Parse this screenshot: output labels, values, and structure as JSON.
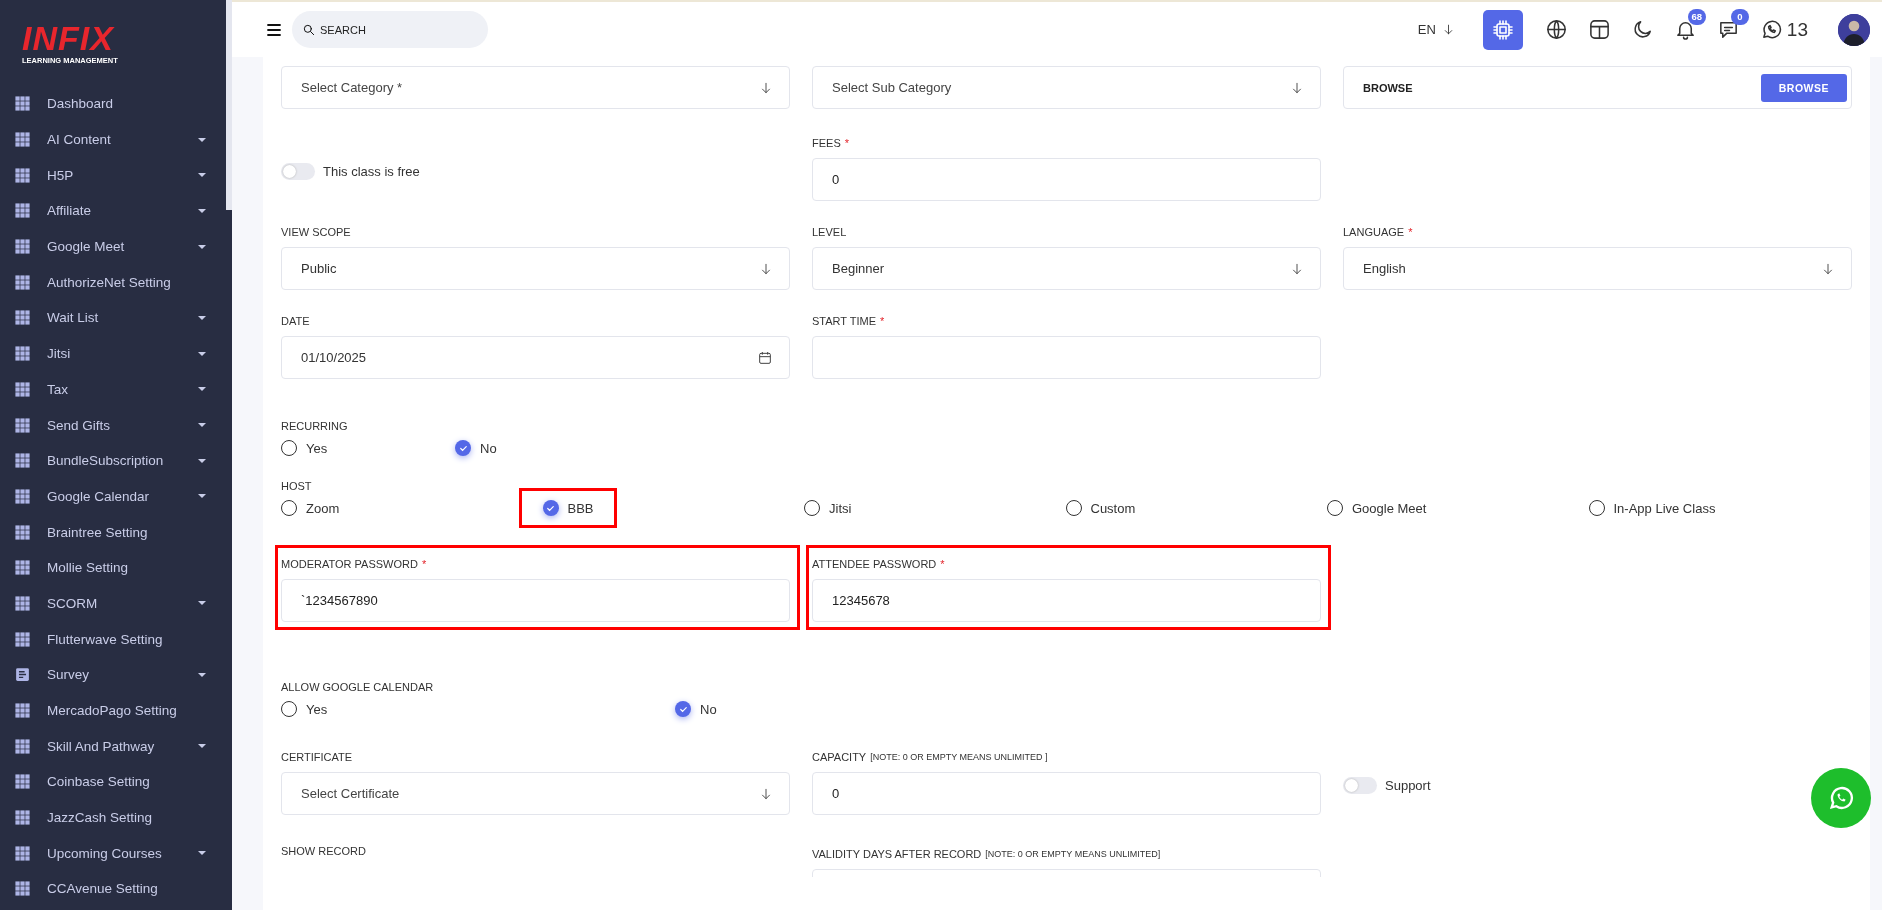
{
  "sidebar": {
    "logo": {
      "title": "INFIX",
      "subtitle": "LEARNING MANAGEMENT"
    },
    "items": [
      {
        "label": "Dashboard",
        "kind": "grid",
        "expandable": false
      },
      {
        "label": "AI Content",
        "kind": "grid",
        "expandable": true
      },
      {
        "label": "H5P",
        "kind": "grid",
        "expandable": true
      },
      {
        "label": "Affiliate",
        "kind": "grid",
        "expandable": true
      },
      {
        "label": "Google Meet",
        "kind": "grid",
        "expandable": true
      },
      {
        "label": "AuthorizeNet Setting",
        "kind": "grid",
        "expandable": false
      },
      {
        "label": "Wait List",
        "kind": "grid",
        "expandable": true
      },
      {
        "label": "Jitsi",
        "kind": "grid",
        "expandable": true
      },
      {
        "label": "Tax",
        "kind": "grid",
        "expandable": true
      },
      {
        "label": "Send Gifts",
        "kind": "grid",
        "expandable": true
      },
      {
        "label": "BundleSubscription",
        "kind": "grid",
        "expandable": true
      },
      {
        "label": "Google Calendar",
        "kind": "grid",
        "expandable": true
      },
      {
        "label": "Braintree Setting",
        "kind": "grid",
        "expandable": false
      },
      {
        "label": "Mollie Setting",
        "kind": "grid",
        "expandable": false
      },
      {
        "label": "SCORM",
        "kind": "grid",
        "expandable": true
      },
      {
        "label": "Flutterwave Setting",
        "kind": "grid",
        "expandable": false
      },
      {
        "label": "Survey",
        "kind": "document",
        "expandable": true
      },
      {
        "label": "MercadoPago Setting",
        "kind": "grid",
        "expandable": false
      },
      {
        "label": "Skill And Pathway",
        "kind": "grid",
        "expandable": true
      },
      {
        "label": "Coinbase Setting",
        "kind": "grid",
        "expandable": false
      },
      {
        "label": "JazzCash Setting",
        "kind": "grid",
        "expandable": false
      },
      {
        "label": "Upcoming Courses",
        "kind": "grid",
        "expandable": true
      },
      {
        "label": "CCAvenue Setting",
        "kind": "grid",
        "expandable": false
      }
    ]
  },
  "header": {
    "search": {
      "placeholder": "SEARCH"
    },
    "language": "EN",
    "ai_button": {
      "active": true
    },
    "notifications": "68",
    "messages": "0",
    "whatsapp_count": "13"
  },
  "form": {
    "rows": [
      {
        "kind": "fields",
        "fields": [
          {
            "kind": "select",
            "placeholder": "Select Category *"
          },
          {
            "kind": "select",
            "placeholder": "Select Sub Category"
          },
          {
            "kind": "browse",
            "value": "BROWSE",
            "button": "BROWSE"
          }
        ]
      },
      {
        "kind": "fields",
        "fields": [
          {
            "kind": "toggle",
            "label": "This class is free",
            "on": false
          },
          {
            "kind": "input",
            "label": "FEES",
            "required_mark": "*",
            "value": "0"
          }
        ]
      },
      {
        "kind": "fields",
        "fields": [
          {
            "kind": "select",
            "label": "VIEW SCOPE",
            "value": "Public"
          },
          {
            "kind": "select",
            "label": "LEVEL",
            "value": "Beginner"
          },
          {
            "kind": "select",
            "label": "LANGUAGE",
            "required_mark": "*",
            "value": "English"
          }
        ]
      },
      {
        "kind": "fields",
        "fields": [
          {
            "kind": "date",
            "label": "DATE",
            "value": "01/10/2025"
          },
          {
            "kind": "input",
            "label": "START TIME",
            "required_mark": "*"
          }
        ]
      },
      {
        "kind": "radio",
        "label": "RECURRING",
        "options": [
          {
            "label": "Yes",
            "selected": false
          },
          {
            "label": "No",
            "selected": true
          }
        ]
      },
      {
        "kind": "radio",
        "label": "HOST",
        "options": [
          {
            "label": "Zoom",
            "selected": false
          },
          {
            "label": "BBB",
            "selected": true,
            "highlighted": true
          },
          {
            "label": "Jitsi",
            "selected": false
          },
          {
            "label": "Custom",
            "selected": false
          },
          {
            "label": "Google Meet",
            "selected": false
          },
          {
            "label": "In-App Live Class",
            "selected": false
          }
        ]
      },
      {
        "kind": "fields",
        "fields": [
          {
            "kind": "input",
            "label": "MODERATOR PASSWORD",
            "required_mark": "*",
            "value": "`1234567890",
            "highlighted": true
          },
          {
            "kind": "input",
            "label": "ATTENDEE PASSWORD",
            "required_mark": "*",
            "value": "12345678",
            "highlighted": true
          }
        ]
      },
      {
        "kind": "radio",
        "label": "ALLOW GOOGLE CALENDAR",
        "options": [
          {
            "label": "Yes",
            "selected": false
          },
          {
            "label": "No",
            "selected": true
          }
        ]
      },
      {
        "kind": "fields",
        "fields": [
          {
            "kind": "select",
            "label": "CERTIFICATE",
            "placeholder": "Select Certificate"
          },
          {
            "kind": "input",
            "label": "CAPACITY",
            "note": "[NOTE: 0 OR EMPTY MEANS UNLIMITED ]",
            "value": "0"
          },
          {
            "kind": "toggle",
            "label": "Support",
            "on": false
          }
        ]
      },
      {
        "kind": "fields",
        "fields": [
          {
            "kind": "text",
            "label": "SHOW RECORD"
          },
          {
            "kind": "input",
            "label": "VALIDITY DAYS AFTER RECORD",
            "note": "[NOTE: 0 OR EMPTY MEANS UNLIMITED]"
          }
        ]
      }
    ]
  }
}
